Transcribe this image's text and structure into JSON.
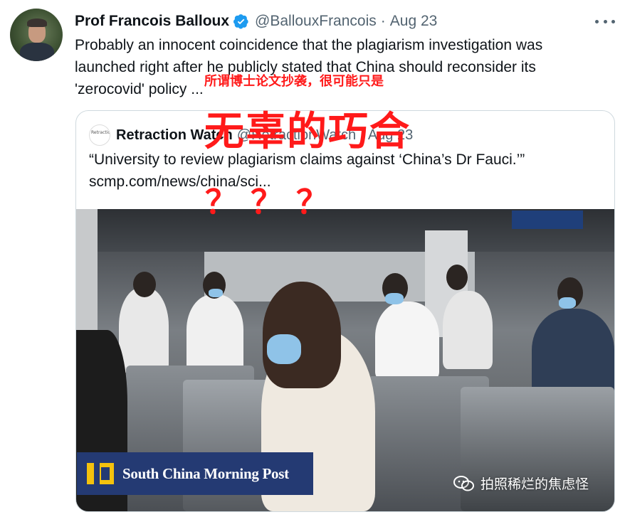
{
  "tweet": {
    "author_name": "Prof Francois Balloux",
    "handle": "@BallouxFrancois",
    "separator": "·",
    "date": "Aug 23",
    "text": "Probably an innocent coincidence that the plagiarism investigation was launched right after he publicly stated that China should reconsider its 'zerocovid' policy ...",
    "avatar_icon": "profile-photo",
    "verified_icon": "verified-badge-icon",
    "more_icon": "more-options-icon"
  },
  "quoted_tweet": {
    "author_name": "Retraction Watch",
    "avatar_text": "Retraction Watch",
    "handle": "@RetractionWatch",
    "separator": "·",
    "date": "Aug 23",
    "text": "“University to review plagiarism claims against ‘China’s Dr Fauci.’”",
    "link": "scmp.com/news/china/sci..."
  },
  "overlay": {
    "caption_small": "所谓博士论文抄袭，很可能只是",
    "caption_big": "无辜的巧合",
    "question_marks": "？？？"
  },
  "media": {
    "publisher_logo_text": "South China Morning Post",
    "watermark_text": "拍照稀烂的焦虑怪",
    "watermark_icon": "wechat-icon"
  },
  "colors": {
    "verified": "#1d9bf0",
    "overlay_red": "#ff1a1a",
    "scmp_blue": "#243a73",
    "scmp_yellow": "#f4c20d",
    "muted_text": "#536471"
  }
}
